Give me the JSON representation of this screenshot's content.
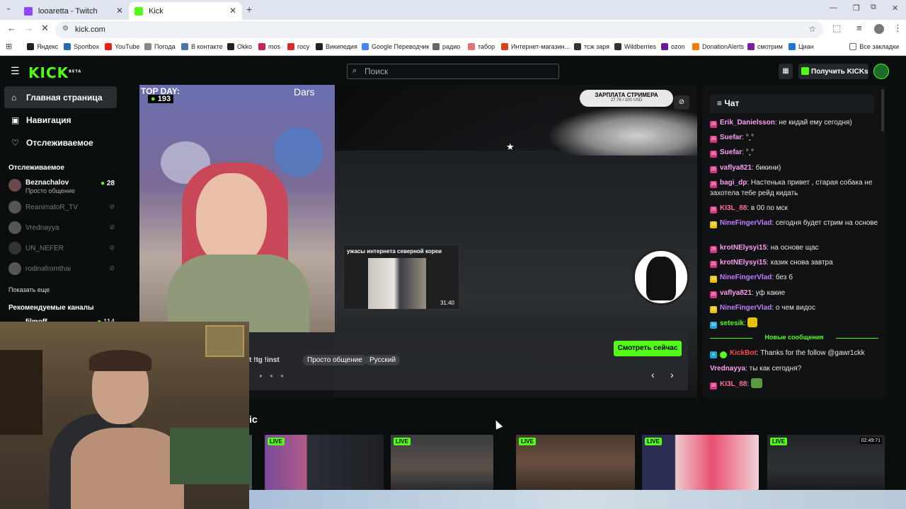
{
  "browser": {
    "tabs": [
      {
        "title": "looaretta - Twitch",
        "active": false,
        "icon_color": "#9146ff"
      },
      {
        "title": "Kick",
        "active": true,
        "icon_color": "#53fc18"
      }
    ],
    "url": "kick.com",
    "bookmarks": [
      {
        "label": "Яндекс",
        "color": "#222"
      },
      {
        "label": "Sportbox",
        "color": "#2a6ab3"
      },
      {
        "label": "YouTube",
        "color": "#e62117"
      },
      {
        "label": "Погода",
        "color": "#888"
      },
      {
        "label": "В контакте",
        "color": "#4a76a8"
      },
      {
        "label": "Okko",
        "color": "#222"
      },
      {
        "label": "mos",
        "color": "#c7254e"
      },
      {
        "label": "госу",
        "color": "#d32f2f"
      },
      {
        "label": "Википедия",
        "color": "#222"
      },
      {
        "label": "Google Переводчик",
        "color": "#4285f4"
      },
      {
        "label": "радио",
        "color": "#666"
      },
      {
        "label": "табор",
        "color": "#e57373"
      },
      {
        "label": "Интернет-магазин...",
        "color": "#d84315"
      },
      {
        "label": "тсж заря",
        "color": "#333"
      },
      {
        "label": "Wildberries",
        "color": "#333"
      },
      {
        "label": "ozon",
        "color": "#6a1b9a"
      },
      {
        "label": "DonationAlerts",
        "color": "#f57c00"
      },
      {
        "label": "смотрим",
        "color": "#7b1fa2"
      },
      {
        "label": "Циан",
        "color": "#1976d2"
      }
    ],
    "all_bookmarks": "Все закладки"
  },
  "kick": {
    "logo": "KICK",
    "logo_beta": "BETA",
    "search_placeholder": "Поиск",
    "get_kicks": "Получить KICKs",
    "accent": "#53fc18"
  },
  "sidebar": {
    "nav": [
      {
        "label": "Главная страница",
        "icon": "home-icon",
        "active": true
      },
      {
        "label": "Навигация",
        "icon": "compass-icon",
        "active": false
      },
      {
        "label": "Отслеживаемое",
        "icon": "heart-icon",
        "active": false
      }
    ],
    "following_title": "Отслеживаемое",
    "following": [
      {
        "name": "Beznachalov",
        "sub": "Просто общение",
        "viewers": "28",
        "live": true
      },
      {
        "name": "ReanimatoR_TV",
        "live": false
      },
      {
        "name": "Vrednayya",
        "live": false
      },
      {
        "name": "UN_NEFER",
        "live": false
      },
      {
        "name": "rodinafromthai",
        "live": false
      }
    ],
    "show_more": "Показать еще",
    "recommended_title": "Рекомендуемые каналы",
    "recommended": [
      {
        "name": "filmoff",
        "viewers": "114"
      }
    ]
  },
  "featured": {
    "top_day": "TOP DAY:",
    "viewers": "193",
    "overlay_name": "Dars",
    "salary_title": "ЗАРПЛАТА СТРИМЕРА",
    "salary_value": "27.76 / 100 USD",
    "clip_title": "ужасы интернета северной кореи",
    "clip_duration": "31:40",
    "stream_title_fragment": "t !tg !inst",
    "tags": [
      "Просто общение",
      "Русский"
    ],
    "watch_now": "Смотреть сейчас"
  },
  "chat": {
    "title": "Чат",
    "new_messages": "Новые сообщения",
    "messages": [
      {
        "badge": "25",
        "badge_color": "#d63384",
        "user": "Erik_Danielsson",
        "color": "#ff9ef5",
        "text": "не кидай ему сегодня)"
      },
      {
        "badge": "25",
        "badge_color": "#d63384",
        "user": "Suefar",
        "color": "#ff9ef5",
        "text": "°˳°",
        "emote": true
      },
      {
        "badge": "25",
        "badge_color": "#d63384",
        "user": "Suefar",
        "color": "#ff9ef5",
        "text": "°˳°",
        "emote": true
      },
      {
        "badge": "25",
        "badge_color": "#d63384",
        "user": "vaflya821",
        "color": "#ff9ef5",
        "text": "бикини)"
      },
      {
        "badge": "25",
        "badge_color": "#d63384",
        "user": "bagi_dp",
        "color": "#ff9ef5",
        "text": "Настенька привет , старая собака не захотела тебе рейд кидать"
      },
      {
        "badge": "25",
        "badge_color": "#d63384",
        "user": "KI3L_88",
        "color": "#ff6b9a",
        "text": "в 00 по мск"
      },
      {
        "badge": "15",
        "badge_color": "#e8c10a",
        "user": "NineFingerVlad",
        "color": "#c47cff",
        "text": "сегодня будет стрим на основе"
      },
      {
        "badge": "25",
        "badge_color": "#d63384",
        "user": "krotNElysyi15",
        "color": "#ff9ef5",
        "text": "на основе щас"
      },
      {
        "badge": "25",
        "badge_color": "#d63384",
        "user": "krotNElysyi15",
        "color": "#ff9ef5",
        "text": "казик снова завтра"
      },
      {
        "badge": "15",
        "badge_color": "#e8c10a",
        "user": "NineFingerVlad",
        "color": "#c47cff",
        "text": "без б"
      },
      {
        "badge": "25",
        "badge_color": "#d63384",
        "user": "vaflya821",
        "color": "#ff9ef5",
        "text": "уф какие"
      },
      {
        "badge": "15",
        "badge_color": "#e8c10a",
        "user": "NineFingerVlad",
        "color": "#c47cff",
        "text": "о чем видос"
      },
      {
        "badge": "34",
        "badge_color": "#1ea7d6",
        "user": "setesik",
        "color": "#53fc18",
        "text": "",
        "emote": true
      }
    ],
    "after_new": [
      {
        "user": "KickBot",
        "color": "#ff4a4a",
        "text": "Thanks for the follow @gawr1ckk",
        "bot": true
      },
      {
        "user": "Vrednayya",
        "color": "#ff9ef5",
        "text": "ты как сегодня?"
      },
      {
        "badge": "20",
        "badge_color": "#d63384",
        "user": "KI3L_88",
        "color": "#ff6b9a",
        "text": "",
        "emote": true
      }
    ]
  },
  "row_title": "ic",
  "live_badge": "LIVE",
  "thumb_time": "02:49:71"
}
